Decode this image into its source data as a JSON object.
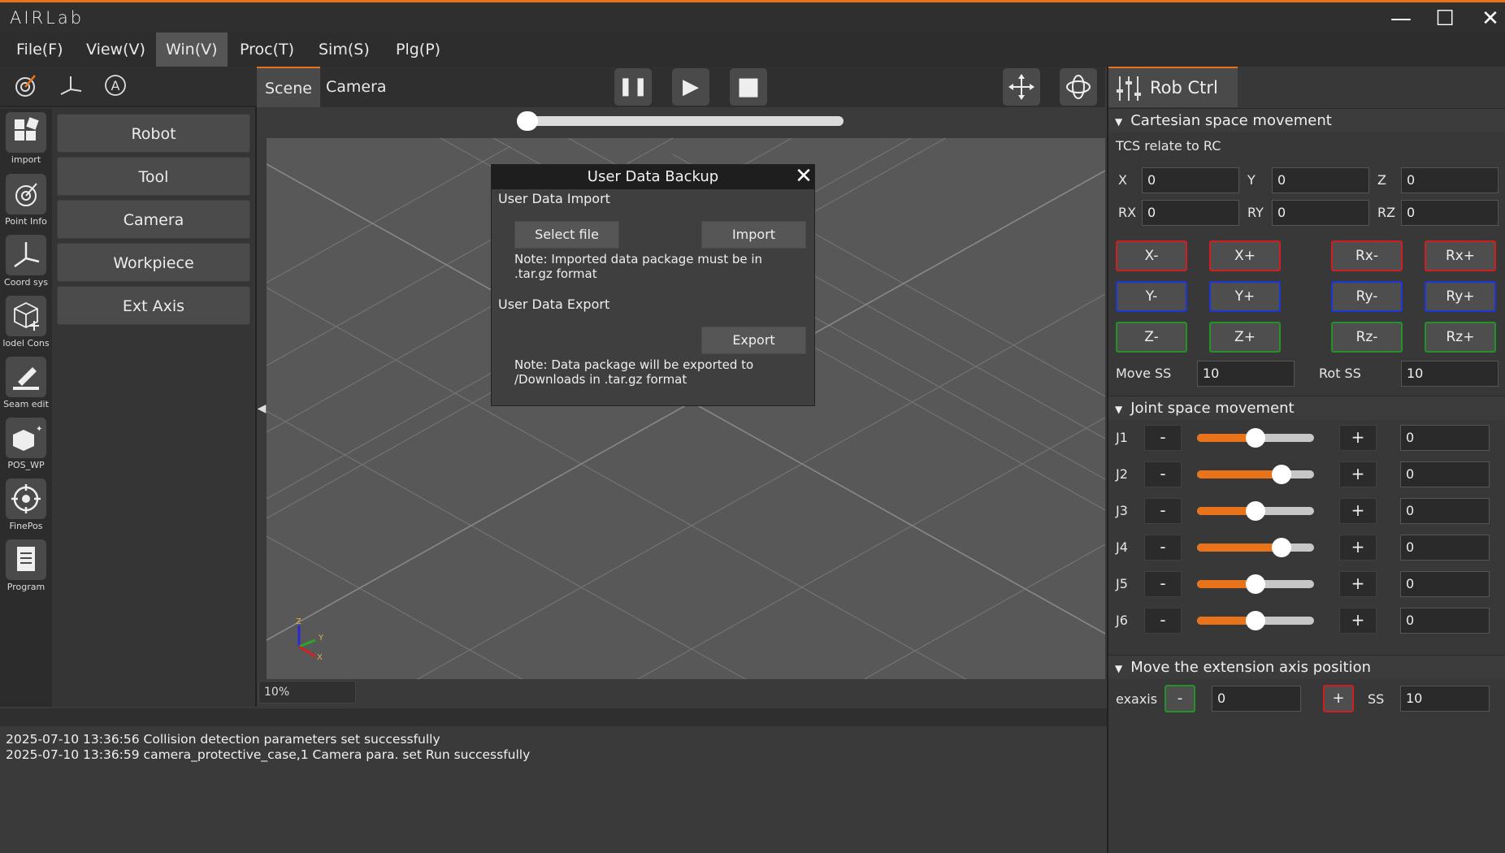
{
  "app": {
    "logo": "AIRLab",
    "minimize": "—",
    "maximize": "☐",
    "close": "✕"
  },
  "menu": [
    {
      "label": "File(F)"
    },
    {
      "label": "View(V)"
    },
    {
      "label": "Win(V)",
      "active": true
    },
    {
      "label": "Proc(T)"
    },
    {
      "label": "Sim(S)"
    },
    {
      "label": "Plg(P)"
    }
  ],
  "sidebar": [
    {
      "label": "import",
      "icon": "grid-icon"
    },
    {
      "label": "Point Info",
      "icon": "target-icon"
    },
    {
      "label": "Coord sys",
      "icon": "axes-icon"
    },
    {
      "label": "lodel Cons",
      "icon": "cube-plus-icon"
    },
    {
      "label": "Seam edit",
      "icon": "pen-icon"
    },
    {
      "label": "POS_WP",
      "icon": "box-icon"
    },
    {
      "label": "FinePos",
      "icon": "crosshair-icon"
    },
    {
      "label": "Program",
      "icon": "document-icon"
    }
  ],
  "categories": [
    "Robot",
    "Tool",
    "Camera",
    "Workpiece",
    "Ext Axis"
  ],
  "scene_tabs": [
    "Scene",
    "Camera"
  ],
  "playback": {
    "pause": "❚❚",
    "play": "▶",
    "stop": "■",
    "progress": 0.0
  },
  "zoom": "10%",
  "axis_labels": {
    "z": "Z",
    "y": "Y",
    "x": "X"
  },
  "dialog": {
    "title": "User Data Backup",
    "close": "✕",
    "import_header": "User Data Import",
    "select_file": "Select file",
    "import_btn": "Import",
    "import_note": "Note: Imported data package must be in .tar.gz format",
    "export_header": "User Data Export",
    "export_btn": "Export",
    "export_note": "Note: Data package will be exported to /Downloads in .tar.gz format"
  },
  "log": [
    "2025-07-10 13:36:56 Collision detection parameters set successfully",
    "2025-07-10 13:36:59 camera_protective_case,1 Camera para. set Run successfully"
  ],
  "rob": {
    "tab": "Rob Ctrl",
    "cart_header": "Cartesian space movement",
    "tcs": "TCS relate to RC",
    "coords": [
      {
        "label": "X",
        "value": "0"
      },
      {
        "label": "Y",
        "value": "0"
      },
      {
        "label": "Z",
        "value": "0"
      },
      {
        "label": "RX",
        "value": "0"
      },
      {
        "label": "RY",
        "value": "0"
      },
      {
        "label": "RZ",
        "value": "0"
      }
    ],
    "jog": [
      [
        "X-",
        "X+",
        "Rx-",
        "Rx+"
      ],
      [
        "Y-",
        "Y+",
        "Ry-",
        "Ry+"
      ],
      [
        "Z-",
        "Z+",
        "Rz-",
        "Rz+"
      ]
    ],
    "move_ss_label": "Move SS",
    "move_ss": "10",
    "rot_ss_label": "Rot SS",
    "rot_ss": "10",
    "joint_header": "Joint space movement",
    "joints": [
      {
        "label": "J1",
        "value": "0",
        "level": 0.5
      },
      {
        "label": "J2",
        "value": "0",
        "level": 0.72
      },
      {
        "label": "J3",
        "value": "0",
        "level": 0.5
      },
      {
        "label": "J4",
        "value": "0",
        "level": 0.72
      },
      {
        "label": "J5",
        "value": "0",
        "level": 0.5
      },
      {
        "label": "J6",
        "value": "0",
        "level": 0.5
      }
    ],
    "minus": "-",
    "plus": "+",
    "ext_header": "Move the extension axis position",
    "exaxis_label": "exaxis",
    "exaxis_value": "0",
    "ss_label": "SS",
    "ss_value": "10"
  }
}
